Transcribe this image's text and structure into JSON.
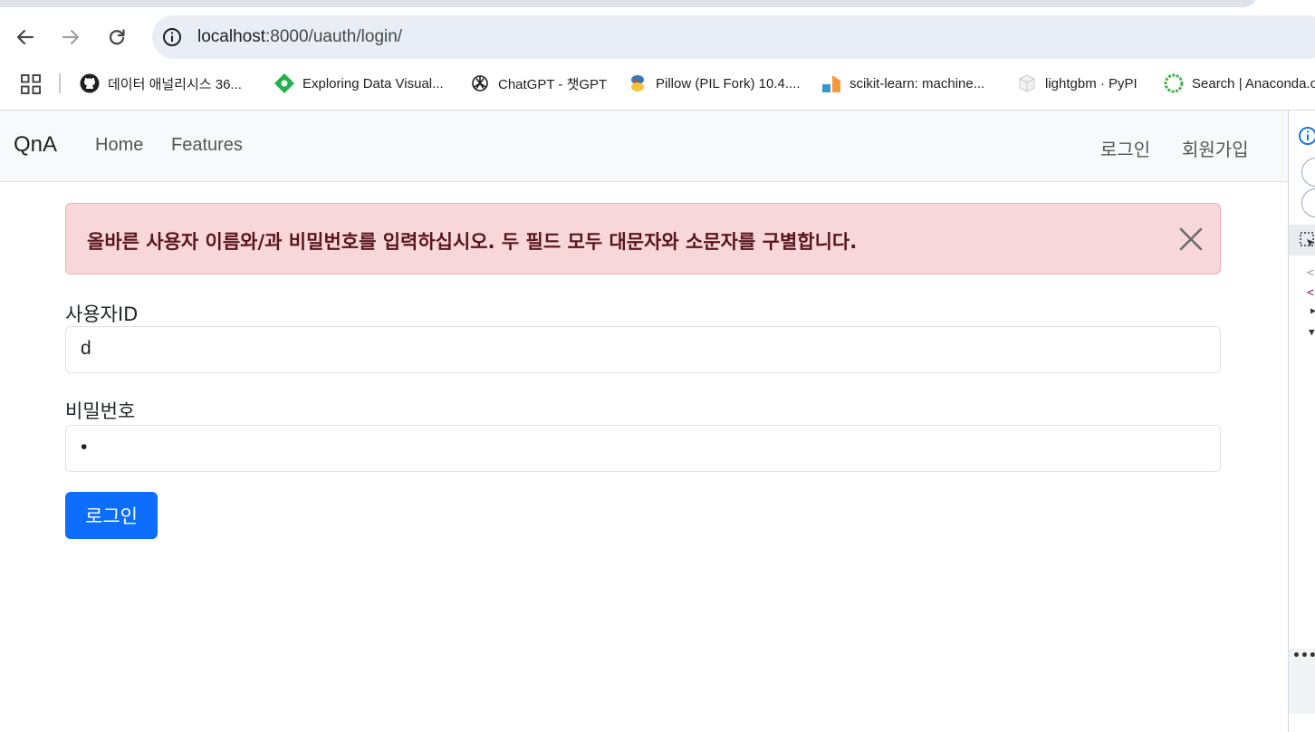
{
  "browser": {
    "url_host": "localhost",
    "url_rest": ":8000/uauth/login/",
    "bookmarks": [
      {
        "label": "데이터 애널리시스 36...",
        "icon": "github-icon"
      },
      {
        "label": "Exploring Data Visual...",
        "icon": "green-diamond-icon"
      },
      {
        "label": "ChatGPT - 챗GPT",
        "icon": "openai-icon"
      },
      {
        "label": "Pillow (PIL Fork) 10.4....",
        "icon": "pillow-icon"
      },
      {
        "label": "scikit-learn: machine...",
        "icon": "sklearn-icon"
      },
      {
        "label": "lightgbm · PyPI",
        "icon": "pypi-icon"
      },
      {
        "label": "Search | Anaconda.org",
        "icon": "anaconda-icon"
      }
    ]
  },
  "navbar": {
    "brand": "QnA",
    "links": [
      "Home",
      "Features"
    ],
    "right_links": [
      "로그인",
      "회원가입"
    ]
  },
  "alert": {
    "message": "올바른 사용자 이름와/과 비밀번호를 입력하십시오. 두 필드 모두 대문자와 소문자를 구별합니다."
  },
  "form": {
    "username_label": "사용자ID",
    "username_value": "d",
    "password_label": "비밀번호",
    "password_value": "•",
    "submit_label": "로그인"
  },
  "colors": {
    "primary": "#0d6efd",
    "alert_bg": "#f8d7da",
    "alert_text": "#58151c",
    "navbar_bg": "#f8f9fa"
  }
}
